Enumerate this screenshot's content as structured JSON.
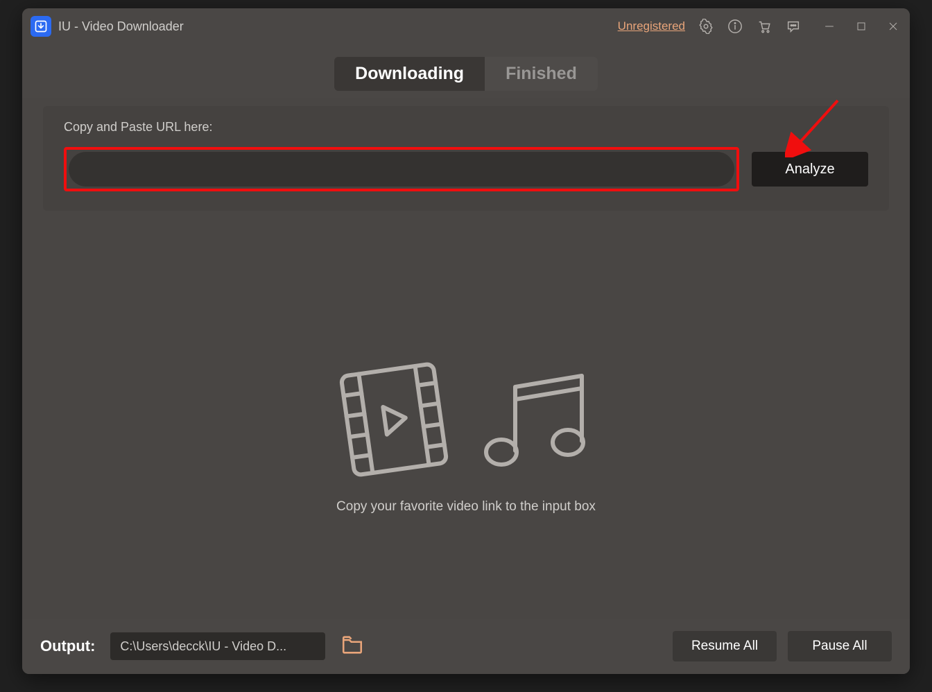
{
  "titlebar": {
    "app_title": "IU - Video Downloader",
    "unregistered_label": "Unregistered"
  },
  "tabs": {
    "downloading": "Downloading",
    "finished": "Finished"
  },
  "url_panel": {
    "label": "Copy and Paste URL here:",
    "input_value": "",
    "input_placeholder": "",
    "analyze_label": "Analyze"
  },
  "empty_state": {
    "message": "Copy your favorite video link to the input box"
  },
  "footer": {
    "output_label": "Output:",
    "output_path": "C:\\Users\\decck\\IU - Video D...",
    "resume_label": "Resume All",
    "pause_label": "Pause All"
  },
  "colors": {
    "highlight_red": "#f00e0e",
    "accent_orange": "#e9a57a"
  }
}
